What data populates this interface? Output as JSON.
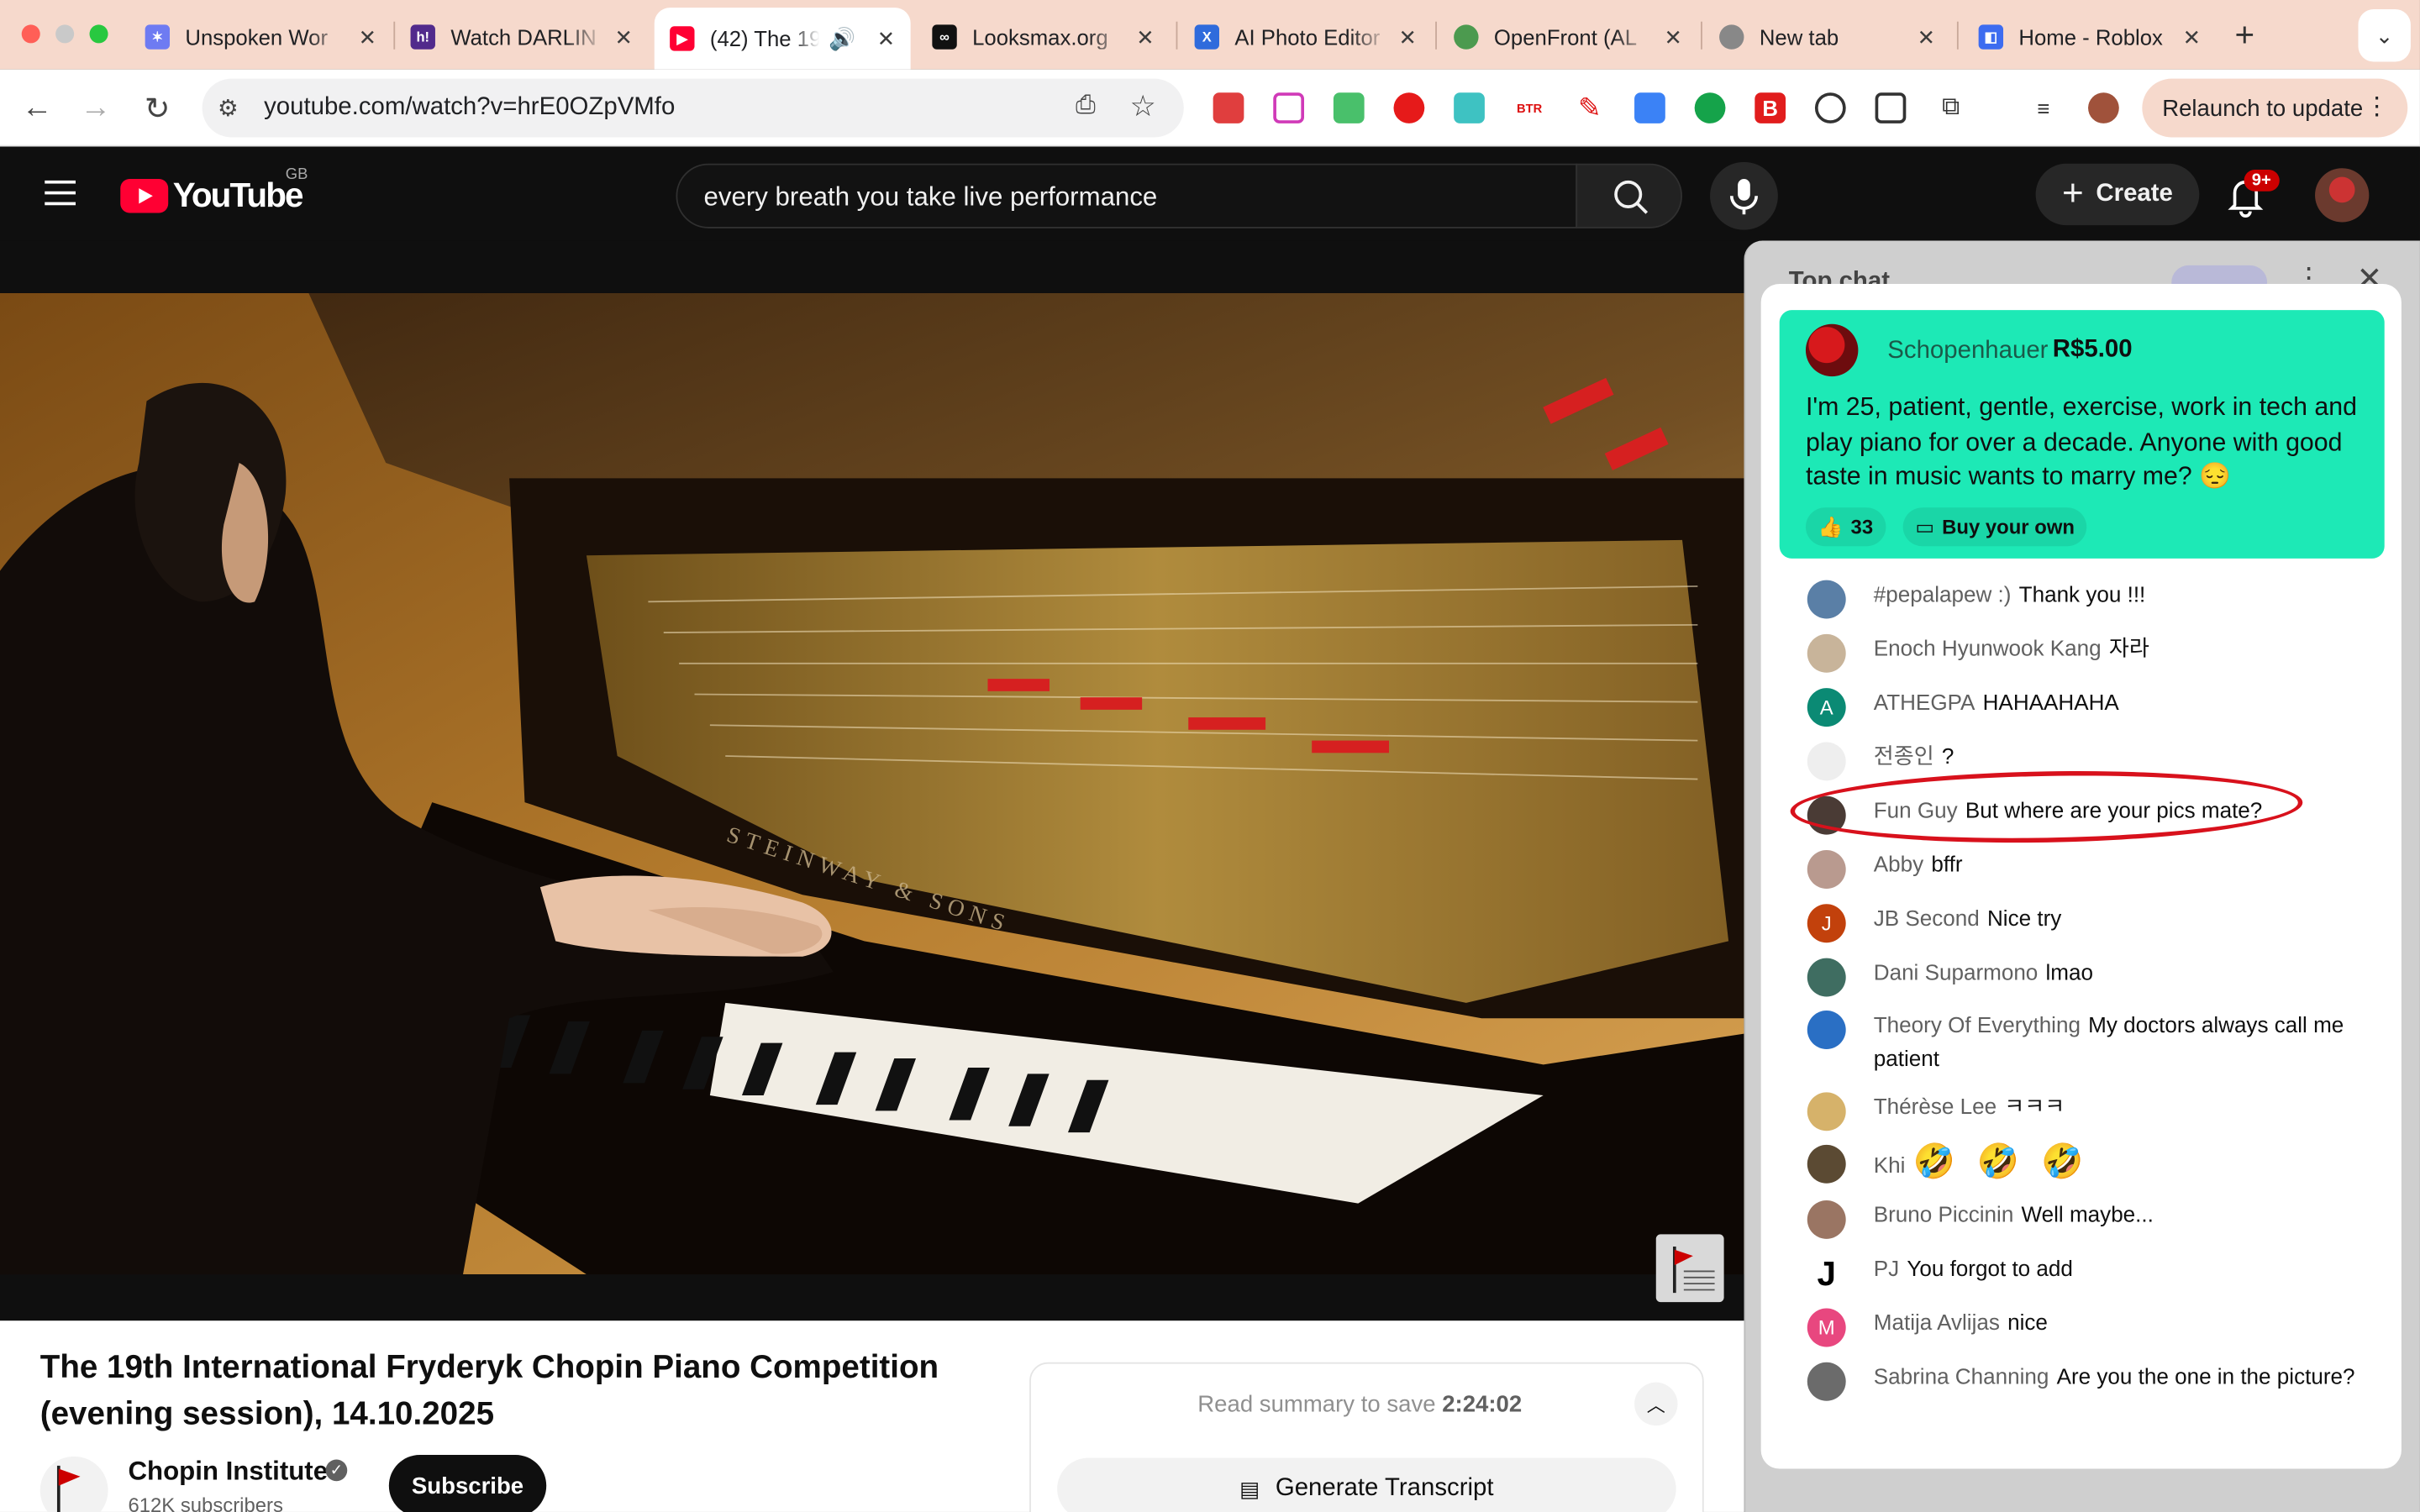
{
  "browser": {
    "tabs": [
      {
        "title": "Unspoken Wor",
        "favicon": "unspoken-favicon",
        "color": "#6e7bf2"
      },
      {
        "title": "Watch DARLIN",
        "favicon": "h-favicon",
        "color": "#512a8c"
      },
      {
        "title": "(42) The 19",
        "favicon": "youtube-favicon",
        "color": "#ff0033"
      },
      {
        "title": "Looksmax.org",
        "favicon": "looksmax-favicon",
        "color": "#111111"
      },
      {
        "title": "AI Photo Editor",
        "favicon": "ai-photo-favicon",
        "color": "#2f6bdc"
      },
      {
        "title": "OpenFront (AL",
        "favicon": "globe-favicon",
        "color": "#4c9a4f"
      },
      {
        "title": "New tab",
        "favicon": "chrome-favicon",
        "color": "#888888"
      },
      {
        "title": "Home - Roblox",
        "favicon": "roblox-favicon",
        "color": "#3d6cf0"
      }
    ],
    "url": "youtube.com/watch?v=hrE0OZpVMfo",
    "relaunch_label": "Relaunch to update"
  },
  "youtube": {
    "logo_text": "YouTube",
    "country_code": "GB",
    "search_query": "every breath you take live performance",
    "create_label": "Create",
    "notification_badge": "9+"
  },
  "video": {
    "title": "The 19th International Fryderyk Chopin Piano Competition (evening session), 14.10.2025",
    "channel_name": "Chopin Institute",
    "subscribers": "612K subscribers",
    "subscribe_label": "Subscribe",
    "summary_text": "Read summary to save",
    "summary_time": "2:24:02",
    "transcript_label": "Generate Transcript",
    "steinway_text": "STEINWAY & SONS"
  },
  "chat": {
    "header": "Top chat",
    "superchat": {
      "author": "Schopenhauer",
      "amount": "R$5.00",
      "message": "I'm 25, patient, gentle, exercise, work in tech and play piano for over a decade. Anyone with good taste in music wants to marry me? 😔",
      "likes": "33",
      "buy_label": "Buy your own"
    },
    "messages": [
      {
        "author": "#pepalapew :)",
        "text": "Thank you !!!",
        "avatar_color": "#5a7fa6",
        "initial": ""
      },
      {
        "author": "Enoch Hyunwook Kang",
        "text": "자라",
        "avatar_color": "#c8b49a",
        "initial": ""
      },
      {
        "author": "ATHEGPA",
        "text": "HAHAAHAHA",
        "avatar_color": "#0b8a74",
        "initial": "A"
      },
      {
        "author": "전종인",
        "text": "?",
        "avatar_color": "#eeeeee",
        "initial": ""
      },
      {
        "author": "Fun Guy",
        "text": "But where are your pics mate?",
        "avatar_color": "#4a3b35",
        "initial": ""
      },
      {
        "author": "Abby",
        "text": "bffr",
        "avatar_color": "#b99a8f",
        "initial": ""
      },
      {
        "author": "JB Second",
        "text": "Nice try",
        "avatar_color": "#c2410c",
        "initial": "J"
      },
      {
        "author": "Dani Suparmono",
        "text": "lmao",
        "avatar_color": "#3f6d61",
        "initial": ""
      },
      {
        "author": "Theory Of Everything",
        "text": "My doctors always call me patient",
        "avatar_color": "#2a6fc4",
        "initial": ""
      },
      {
        "author": "Thérèse Lee",
        "text": "ㅋㅋㅋ",
        "avatar_color": "#d6b26a",
        "initial": ""
      },
      {
        "author": "Khi",
        "text": "🤣 🤣 🤣",
        "avatar_color": "#5b4a33",
        "initial": ""
      },
      {
        "author": "Bruno Piccinin",
        "text": "Well maybe...",
        "avatar_color": "#9a7563",
        "initial": ""
      },
      {
        "author": "PJ",
        "text": "You forgot to add",
        "avatar_color": "#ffffff",
        "initial": "J"
      },
      {
        "author": "Matija Avlijas",
        "text": "nice",
        "avatar_color": "#e8477f",
        "initial": "M"
      },
      {
        "author": "Sabrina Channing",
        "text": "Are you the one in the picture?",
        "avatar_color": "#6b6b6b",
        "initial": ""
      }
    ]
  }
}
